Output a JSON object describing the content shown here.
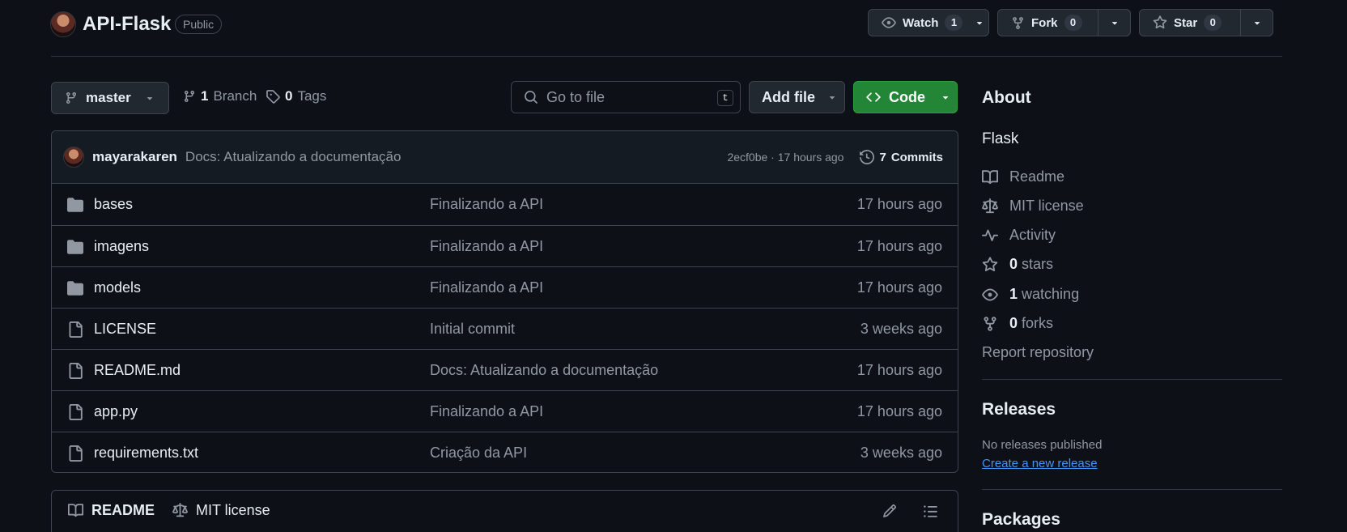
{
  "repo": {
    "name": "API-Flask",
    "visibility": "Public"
  },
  "header": {
    "watch": {
      "label": "Watch",
      "count": "1"
    },
    "fork": {
      "label": "Fork",
      "count": "0"
    },
    "star": {
      "label": "Star",
      "count": "0"
    }
  },
  "branchbar": {
    "branch": "master",
    "branches_count": "1",
    "branches_label": "Branch",
    "tags_count": "0",
    "tags_label": "Tags",
    "goto_placeholder": "Go to file",
    "goto_shortcut": "t",
    "add_file": "Add file",
    "code": "Code"
  },
  "latest_commit": {
    "author": "mayarakaren",
    "message": "Docs: Atualizando a documentação",
    "meta": "2ecf0be · 17 hours ago",
    "commits_count": "7",
    "commits_label": "Commits"
  },
  "files": [
    {
      "type": "folder",
      "name": "bases",
      "message": "Finalizando a API",
      "age": "17 hours ago"
    },
    {
      "type": "folder",
      "name": "imagens",
      "message": "Finalizando a API",
      "age": "17 hours ago"
    },
    {
      "type": "folder",
      "name": "models",
      "message": "Finalizando a API",
      "age": "17 hours ago"
    },
    {
      "type": "file",
      "name": "LICENSE",
      "message": "Initial commit",
      "age": "3 weeks ago"
    },
    {
      "type": "file",
      "name": "README.md",
      "message": "Docs: Atualizando a documentação",
      "age": "17 hours ago"
    },
    {
      "type": "file",
      "name": "app.py",
      "message": "Finalizando a API",
      "age": "17 hours ago"
    },
    {
      "type": "file",
      "name": "requirements.txt",
      "message": "Criação da API",
      "age": "3 weeks ago"
    }
  ],
  "readme_tabs": {
    "readme": "README",
    "license": "MIT license"
  },
  "about": {
    "heading": "About",
    "description": "Flask",
    "readme": "Readme",
    "license": "MIT license",
    "activity": "Activity",
    "stars_count": "0",
    "stars_label": "stars",
    "watching_count": "1",
    "watching_label": "watching",
    "forks_count": "0",
    "forks_label": "forks",
    "report": "Report repository"
  },
  "releases": {
    "heading": "Releases",
    "none": "No releases published",
    "create": "Create a new release"
  },
  "packages": {
    "heading": "Packages"
  },
  "colors": {
    "background": "#0d1117",
    "code_button": "#238636",
    "link": "#4493f8"
  }
}
